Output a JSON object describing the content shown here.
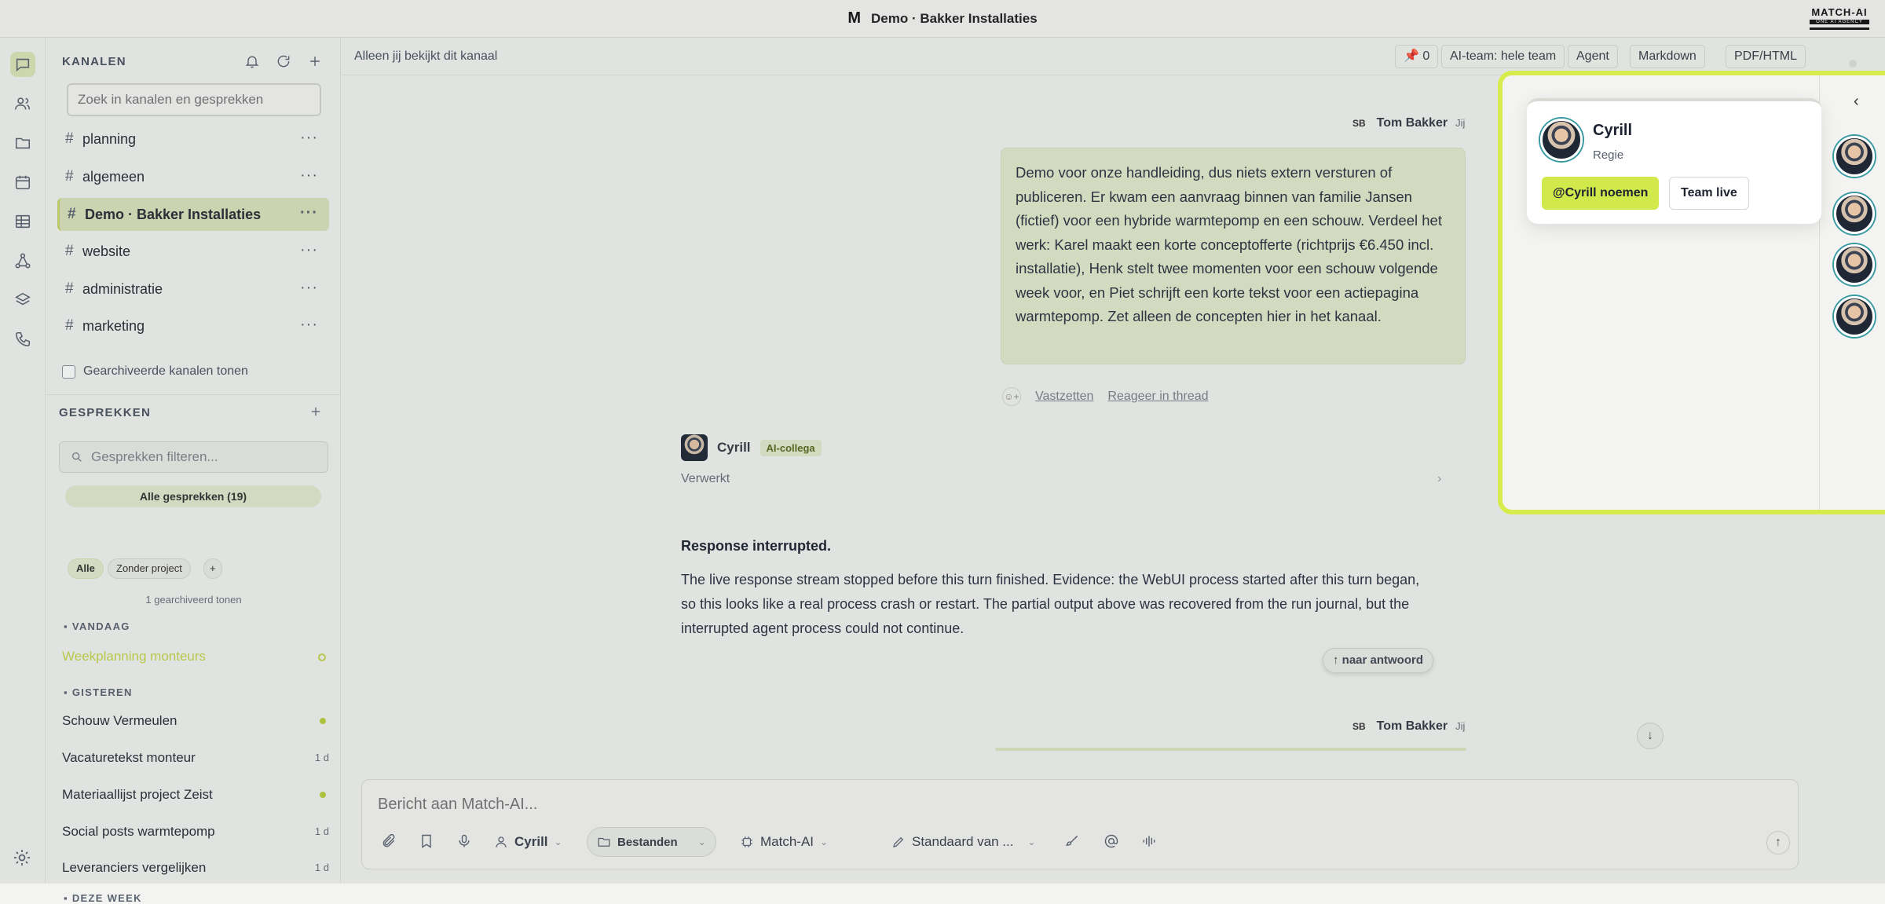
{
  "window": {
    "title": "Demo · Bakker Installaties",
    "logo": "M",
    "brand": "MATCH-AI",
    "brand_tag": "ONE AI AGENCY"
  },
  "rail": {
    "items": [
      "chat-icon",
      "users-icon",
      "folder-icon",
      "calendar-icon",
      "table-icon",
      "network-icon",
      "layers-icon",
      "phone-icon"
    ],
    "settings": "gear-icon"
  },
  "channels": {
    "header": "KANALEN",
    "search_placeholder": "Zoek in kanalen en gesprekken",
    "items": [
      {
        "label": "planning"
      },
      {
        "label": "algemeen"
      },
      {
        "label": "Demo · Bakker Installaties",
        "selected": true
      },
      {
        "label": "website"
      },
      {
        "label": "administratie"
      },
      {
        "label": "marketing"
      }
    ],
    "show_archived": "Gearchiveerde kanalen tonen"
  },
  "conversations": {
    "header": "GESPREKKEN",
    "filter_placeholder": "Gesprekken filteren...",
    "all_label": "Alle gesprekken (19)",
    "pills": [
      "Alle",
      "Zonder project",
      "+"
    ],
    "archived_note": "1 gearchiveerd tonen",
    "groups": {
      "today": "VANDAAG",
      "yesterday": "GISTEREN",
      "week": "DEZE WEEK"
    },
    "today": [
      {
        "title": "Weekplanning monteurs"
      }
    ],
    "yesterday": [
      {
        "title": "Schouw Vermeulen",
        "meta": ""
      },
      {
        "title": "Vacaturetekst monteur",
        "meta": "1 d"
      },
      {
        "title": "Materiaallijst project Zeist",
        "meta": ""
      },
      {
        "title": "Social posts warmtepomp",
        "meta": "1 d"
      },
      {
        "title": "Leveranciers vergelijken",
        "meta": "1 d"
      }
    ]
  },
  "toolbar": {
    "visibility": "Alleen jij bekijkt dit kanaal",
    "pins": "📌 0",
    "ai_team": "AI-team: hele team",
    "agent": "Agent",
    "markdown": "Markdown",
    "pdf": "PDF/HTML"
  },
  "messages": {
    "user_initials": "SB",
    "user_name": "Tom Bakker",
    "user_you": "Jij",
    "user_text": "Demo voor onze handleiding, dus niets extern versturen of publiceren. Er kwam een aanvraag binnen van familie Jansen (fictief) voor een hybride warmtepomp en een schouw. Verdeel het werk: Karel maakt een korte conceptofferte (richtprijs €6.450 incl. installatie), Henk stelt twee momenten voor een schouw volgende week voor, en Piet schrijft een korte tekst voor een actiepagina warmtepomp. Zet alleen de concepten hier in het kanaal.",
    "emoji_add": "☺+",
    "pin_action": "Vastzetten",
    "thread_action": "Reageer in thread",
    "ai_name": "Cyrill",
    "ai_badge": "AI-collega",
    "status": "Verwerkt",
    "chevron": "›",
    "resp_title": "Response interrupted.",
    "resp_text": "The live response stream stopped before this turn finished. Evidence: the WebUI process started after this turn began, so this looks like a real process crash or restart. The partial output above was recovered from the run journal, but the interrupted agent process could not continue.",
    "to_answer": "↑ naar antwoord",
    "scroll_down": "↓"
  },
  "composer": {
    "placeholder": "Bericht aan Match-AI...",
    "agent": "Cyrill",
    "files": "Bestanden",
    "model": "Match-AI",
    "style": "Standaard van ...",
    "send": "↑"
  },
  "panel": {
    "collapse": "‹",
    "card_name": "Cyrill",
    "card_role": "Regie",
    "mention_btn": "@Cyrill noemen",
    "live_btn": "Team live"
  },
  "colors": {
    "accent": "#d2e94b",
    "bubble": "#e3eacd",
    "ring": "#3a9aa1"
  }
}
